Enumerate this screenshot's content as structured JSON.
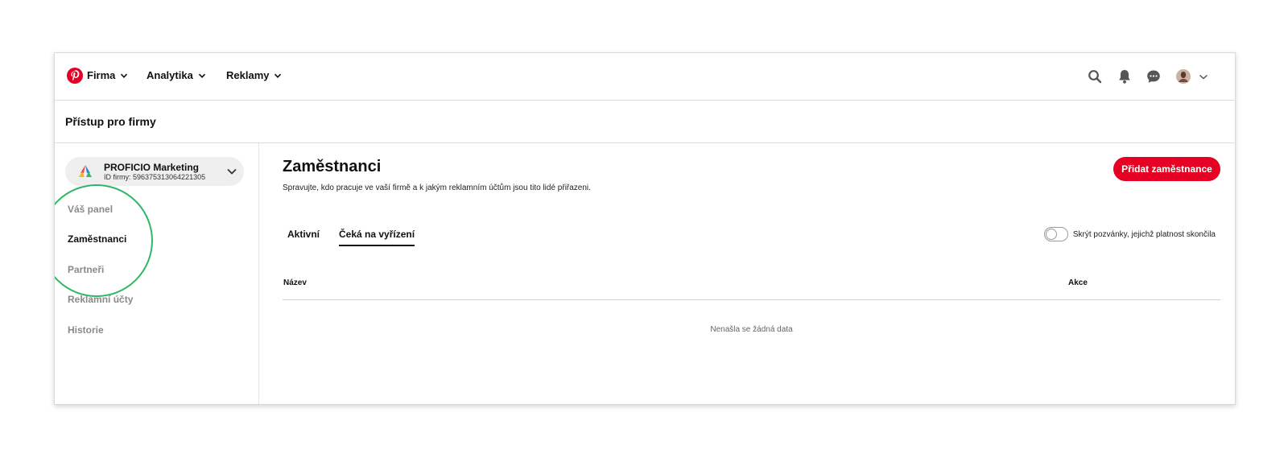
{
  "topnav": {
    "items": [
      {
        "label": "Firma"
      },
      {
        "label": "Analytika"
      },
      {
        "label": "Reklamy"
      }
    ],
    "icons": [
      "search-icon",
      "bell-icon",
      "chat-icon",
      "avatar",
      "chevron-down-icon"
    ]
  },
  "page": {
    "title": "Přístup pro firmy"
  },
  "sidebar": {
    "company": {
      "name": "PROFICIO Marketing",
      "id_line": "ID firmy: 596375313064221305"
    },
    "items": [
      {
        "label": "Váš panel"
      },
      {
        "label": "Zaměstnanci"
      },
      {
        "label": "Partneři"
      },
      {
        "label": "Reklamní účty"
      },
      {
        "label": "Historie"
      }
    ],
    "active_index": 1
  },
  "main": {
    "title": "Zaměstnanci",
    "description": "Spravujte, kdo pracuje ve vaší firmě a k jakým reklamním účtům jsou tito lidé přiřazeni.",
    "add_button": "Přidat zaměstnance",
    "tabs": [
      {
        "label": "Aktivní"
      },
      {
        "label": "Čeká na vyřízení"
      }
    ],
    "active_tab": 1,
    "toggle_label": "Skrýt pozvánky, jejichž platnost skončila",
    "toggle_on": false,
    "table": {
      "columns": [
        "Název",
        "Akce"
      ],
      "empty_text": "Nenašla se žádná data"
    }
  },
  "colors": {
    "brand": "#e60023",
    "highlight": "#2fb767"
  }
}
